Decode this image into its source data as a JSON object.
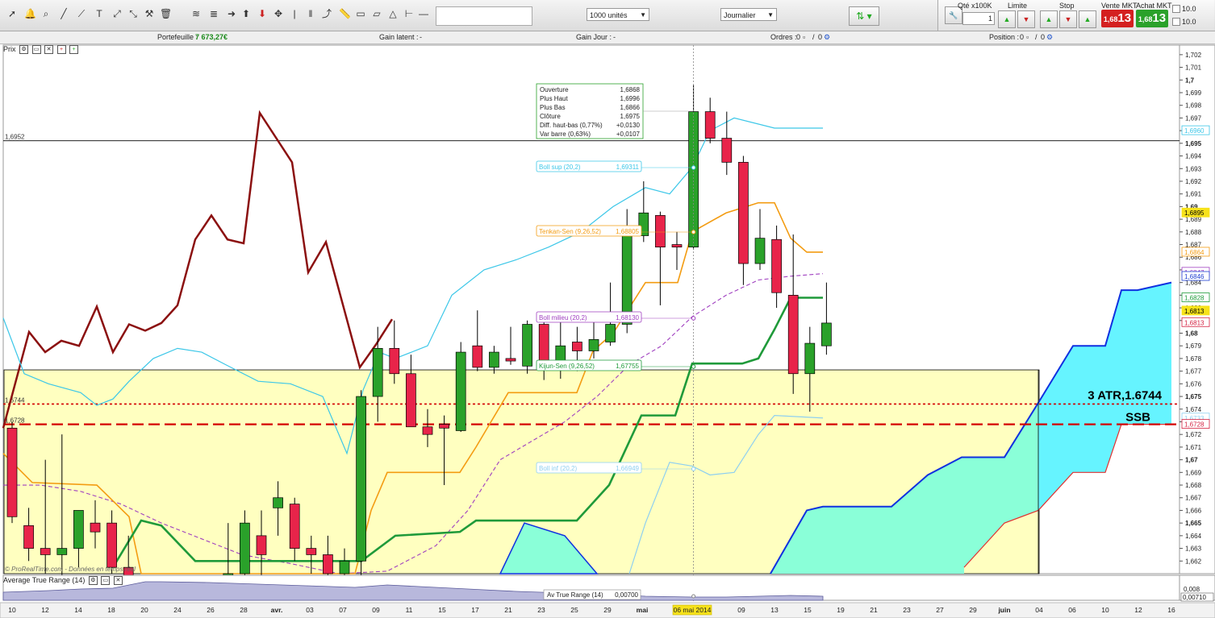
{
  "toolbar": {
    "quantity_select": "1000 unités",
    "period_select": "Journalier",
    "qty_label": "Qté x100K",
    "qty_value": "1",
    "limit_label": "Limite",
    "stop_label": "Stop",
    "sell_label": "Vente MKT",
    "buy_label": "Achat MKT",
    "sell_price_small": "1,68",
    "sell_price_big": "13",
    "buy_price_small": "1,68",
    "buy_price_big": "13",
    "right_values": [
      "10.0",
      "10.0"
    ],
    "colors": {
      "sell": "#d42020",
      "buy": "#2aa12a"
    }
  },
  "infobar": {
    "portfolio_label": "Portefeuille :",
    "portfolio_value": "7 673,27€",
    "latent_label": "Gain latent :",
    "latent_value": "-",
    "day_label": "Gain Jour :",
    "day_value": "-",
    "orders_label": "Ordres :",
    "orders_value": "0",
    "orders_value2": "0",
    "position_label": "Position :",
    "position_value": "0",
    "position_value2": "0"
  },
  "chart_title": "Prix",
  "watermark": "© ProRealTime.com - Données en temps réel",
  "atr_title": "Average True Range (14)",
  "tooltip": {
    "rows": [
      [
        "Ouverture",
        "1,6868"
      ],
      [
        "Plus Haut",
        "1,6996"
      ],
      [
        "Plus Bas",
        "1,6866"
      ],
      [
        "Clôture",
        "1,6975"
      ],
      [
        "Diff. haut-bas (0,77%)",
        "+0,0130"
      ],
      [
        "Var barre (0,63%)",
        "+0,0107"
      ]
    ]
  },
  "chart_data": {
    "type": "candlestick",
    "x": [
      "10",
      "11",
      "12",
      "13",
      "14",
      "17",
      "18",
      "19",
      "20",
      "21",
      "24",
      "25",
      "26",
      "27",
      "28",
      "31",
      "avr.",
      "02",
      "03",
      "04",
      "07",
      "08",
      "09",
      "10",
      "11",
      "14",
      "15",
      "16",
      "17",
      "18",
      "21",
      "22",
      "23",
      "24",
      "25",
      "28",
      "29",
      "30",
      "mai",
      "02",
      "05",
      "06",
      "07",
      "08",
      "09",
      "12",
      "13",
      "14",
      "15",
      "16"
    ],
    "candles": [
      {
        "o": 1.6725,
        "h": 1.673,
        "l": 1.665,
        "c": 1.6655
      },
      {
        "o": 1.6648,
        "h": 1.6662,
        "l": 1.662,
        "c": 1.663
      },
      {
        "o": 1.663,
        "h": 1.67,
        "l": 1.661,
        "c": 1.6625
      },
      {
        "o": 1.6625,
        "h": 1.672,
        "l": 1.6605,
        "c": 1.663
      },
      {
        "o": 1.663,
        "h": 1.666,
        "l": 1.6615,
        "c": 1.666
      },
      {
        "o": 1.665,
        "h": 1.6668,
        "l": 1.663,
        "c": 1.6643
      },
      {
        "o": 1.665,
        "h": 1.666,
        "l": 1.661,
        "c": 1.6615
      },
      {
        "o": 1.6615,
        "h": 1.664,
        "l": 1.66,
        "c": 1.66
      },
      {
        "o": 1.66,
        "h": 1.66,
        "l": 1.66,
        "c": 1.66
      },
      {
        "o": 1.66,
        "h": 1.66,
        "l": 1.66,
        "c": 1.66
      },
      {
        "o": 1.66,
        "h": 1.66,
        "l": 1.66,
        "c": 1.66
      },
      {
        "o": 1.66,
        "h": 1.66,
        "l": 1.66,
        "c": 1.66
      },
      {
        "o": 1.66,
        "h": 1.66,
        "l": 1.66,
        "c": 1.66
      },
      {
        "o": 1.66,
        "h": 1.665,
        "l": 1.66,
        "c": 1.661
      },
      {
        "o": 1.661,
        "h": 1.666,
        "l": 1.66,
        "c": 1.665
      },
      {
        "o": 1.664,
        "h": 1.666,
        "l": 1.66,
        "c": 1.6625
      },
      {
        "o": 1.6662,
        "h": 1.6683,
        "l": 1.664,
        "c": 1.667
      },
      {
        "o": 1.6665,
        "h": 1.667,
        "l": 1.662,
        "c": 1.663
      },
      {
        "o": 1.663,
        "h": 1.664,
        "l": 1.661,
        "c": 1.6625
      },
      {
        "o": 1.6625,
        "h": 1.664,
        "l": 1.66,
        "c": 1.661
      },
      {
        "o": 1.661,
        "h": 1.663,
        "l": 1.66,
        "c": 1.662
      },
      {
        "o": 1.662,
        "h": 1.6755,
        "l": 1.6605,
        "c": 1.675
      },
      {
        "o": 1.675,
        "h": 1.6805,
        "l": 1.673,
        "c": 1.6788
      },
      {
        "o": 1.6788,
        "h": 1.681,
        "l": 1.676,
        "c": 1.6768
      },
      {
        "o": 1.6768,
        "h": 1.6783,
        "l": 1.673,
        "c": 1.6726
      },
      {
        "o": 1.6726,
        "h": 1.674,
        "l": 1.671,
        "c": 1.672
      },
      {
        "o": 1.6728,
        "h": 1.6735,
        "l": 1.668,
        "c": 1.6725
      },
      {
        "o": 1.6723,
        "h": 1.6793,
        "l": 1.6722,
        "c": 1.6785
      },
      {
        "o": 1.679,
        "h": 1.6818,
        "l": 1.677,
        "c": 1.6773
      },
      {
        "o": 1.6773,
        "h": 1.679,
        "l": 1.6768,
        "c": 1.6785
      },
      {
        "o": 1.678,
        "h": 1.6805,
        "l": 1.6775,
        "c": 1.6778
      },
      {
        "o": 1.6774,
        "h": 1.681,
        "l": 1.6768,
        "c": 1.6807
      },
      {
        "o": 1.6807,
        "h": 1.6815,
        "l": 1.6763,
        "c": 1.6772
      },
      {
        "o": 1.6772,
        "h": 1.6813,
        "l": 1.6764,
        "c": 1.679
      },
      {
        "o": 1.6793,
        "h": 1.6805,
        "l": 1.677,
        "c": 1.6786
      },
      {
        "o": 1.6786,
        "h": 1.681,
        "l": 1.678,
        "c": 1.6795
      },
      {
        "o": 1.6793,
        "h": 1.684,
        "l": 1.679,
        "c": 1.6807
      },
      {
        "o": 1.6807,
        "h": 1.6898,
        "l": 1.68,
        "c": 1.6877
      },
      {
        "o": 1.6877,
        "h": 1.692,
        "l": 1.6872,
        "c": 1.6895
      },
      {
        "o": 1.6893,
        "h": 1.6896,
        "l": 1.6822,
        "c": 1.6868
      },
      {
        "o": 1.687,
        "h": 1.688,
        "l": 1.685,
        "c": 1.6868
      },
      {
        "o": 1.6868,
        "h": 1.6996,
        "l": 1.6866,
        "c": 1.6975
      },
      {
        "o": 1.6975,
        "h": 1.6986,
        "l": 1.695,
        "c": 1.6954
      },
      {
        "o": 1.6954,
        "h": 1.6975,
        "l": 1.6925,
        "c": 1.6935
      },
      {
        "o": 1.6935,
        "h": 1.694,
        "l": 1.6838,
        "c": 1.6855
      },
      {
        "o": 1.6855,
        "h": 1.6898,
        "l": 1.685,
        "c": 1.6875
      },
      {
        "o": 1.6874,
        "h": 1.6885,
        "l": 1.682,
        "c": 1.6832
      },
      {
        "o": 1.683,
        "h": 1.6878,
        "l": 1.6752,
        "c": 1.6768
      },
      {
        "o": 1.6768,
        "h": 1.6805,
        "l": 1.6738,
        "c": 1.6792
      },
      {
        "o": 1.679,
        "h": 1.684,
        "l": 1.6783,
        "c": 1.6808
      }
    ],
    "ylim": [
      1.661,
      1.7025
    ],
    "y_ticks": [
      "1,702",
      "1,701",
      "1,7",
      "1,699",
      "1,698",
      "1,697",
      "1,696",
      "1,695",
      "1,694",
      "1,693",
      "1,692",
      "1,691",
      "1,69",
      "1,689",
      "1,688",
      "1,687",
      "1,686",
      "1,685",
      "1,684",
      "1,683",
      "1,682",
      "1,681",
      "1,68",
      "1,679",
      "1,678",
      "1,677",
      "1,676",
      "1,675",
      "1,674",
      "1,673",
      "1,672",
      "1,671",
      "1,67",
      "1,669",
      "1,668",
      "1,667",
      "1,666",
      "1,665",
      "1,664",
      "1,663",
      "1,662"
    ],
    "x_ticks": [
      "10",
      "12",
      "14",
      "18",
      "20",
      "24",
      "26",
      "28",
      "avr.",
      "03",
      "07",
      "09",
      "11",
      "15",
      "17",
      "21",
      "23",
      "25",
      "29",
      "mai",
      "06 mai 2014",
      "09",
      "13",
      "15",
      "19",
      "21",
      "23",
      "27",
      "29",
      "juin",
      "04",
      "06",
      "10",
      "12",
      "16"
    ],
    "indicators": [
      {
        "name": "Boll sup (20,2)",
        "value": "1,69311",
        "color": "#3cc7e8"
      },
      {
        "name": "Tenkan-Sen (9,26,52)",
        "value": "1,68805",
        "color": "#f39c12"
      },
      {
        "name": "Boll milieu (20,2)",
        "value": "1,68130",
        "color": "#a040c0"
      },
      {
        "name": "Kijun-Sen (9,26,52)",
        "value": "1,67755",
        "color": "#1f9a3a"
      },
      {
        "name": "Boll inf (20,2)",
        "value": "1,66949",
        "color": "#8ecff0"
      }
    ],
    "right_labels": [
      {
        "value": "1,6960",
        "color": "#3cc7e8"
      },
      {
        "value": "1,6895",
        "color": "#f7e21b"
      },
      {
        "value": "1,6864",
        "color": "#f39c12"
      },
      {
        "value": "1,6847",
        "color": "#a040c0"
      },
      {
        "value": "1,6846",
        "color": "#2040d0"
      },
      {
        "value": "1,6828",
        "color": "#1f9a3a"
      },
      {
        "value": "1,6813",
        "color": "#f7e21b"
      },
      {
        "value": "1,6813",
        "color": "#d42040"
      },
      {
        "value": "1,6733",
        "color": "#8ecff0"
      },
      {
        "value": "1,6728",
        "color": "#d42040"
      }
    ],
    "hlines": [
      {
        "label": "1,6952",
        "value": 1.6952,
        "color": "#000"
      },
      {
        "label": "1,6744",
        "value": 1.6744,
        "color": "#d40000"
      },
      {
        "label": "1,6728",
        "value": 1.6728,
        "color": "#d40000"
      }
    ],
    "annotations": [
      {
        "text": "3 ATR,1.6744"
      },
      {
        "text": "SSB"
      }
    ],
    "atr": {
      "tooltip_name": "Av True Range (14)",
      "tooltip_value": "0,00700",
      "y_ticks": [
        "0,008",
        "0,00710"
      ]
    }
  }
}
